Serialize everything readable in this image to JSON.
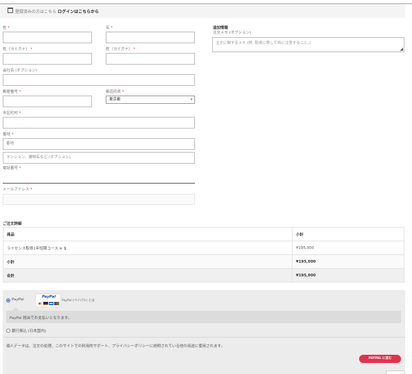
{
  "login": {
    "prompt": "登録済みの方はこちら",
    "link": "ログインはこちらから"
  },
  "billing": {
    "last_name": {
      "label": "姓",
      "value": ""
    },
    "first_name": {
      "label": "名",
      "value": ""
    },
    "last_name_kana": {
      "label": "姓（ヨミガナ）",
      "value": ""
    },
    "first_name_kana": {
      "label": "姓（ヨミガナ）",
      "value": ""
    },
    "company": {
      "label": "会社名 (オプション)",
      "value": ""
    },
    "postcode": {
      "label": "郵便番号",
      "value": ""
    },
    "prefecture": {
      "label": "都道府県",
      "value": "東京都"
    },
    "city": {
      "label": "市区町村",
      "value": ""
    },
    "address": {
      "label": "番地",
      "placeholder": "番地"
    },
    "address2": {
      "placeholder": "マンション、建物名など (オプション)"
    },
    "phone": {
      "label": "電話番号",
      "value": ""
    },
    "email": {
      "label": "メールアドレス",
      "value": ""
    },
    "required_mark": "*"
  },
  "additional": {
    "heading": "追加情報",
    "notes_label": "注文メモ (オプション)",
    "notes_placeholder": "注文に関するメモ (例: 配達に際して特に注意すること。)"
  },
  "order": {
    "heading": "ご注文詳細",
    "col_product": "商品",
    "col_subtotal": "小計",
    "item_name": "ライセンス取得1年短期コース",
    "item_qty": "× 1",
    "item_price": "¥195,000",
    "subtotal_label": "小計",
    "subtotal_value": "¥195,000",
    "total_label": "合計",
    "total_value": "¥195,000"
  },
  "payment": {
    "paypal_label": "PayPal",
    "paypal_logo_text": "PayPal",
    "paypal_about": "PayPal (ペイパル) とは",
    "paypal_desc": "PayPal 経由でお支払いとなります。",
    "bank_label": "銀行振込 (日本国内)",
    "privacy_text": "個人データは、注文の処理、このサイトでの利用的サポート、プライバシーポリシーに説明されている他の用途に使用されます。",
    "button_label": "PAYPAL に進む",
    "accent_color": "#e2334d",
    "paypal_blue": "#1a4ca0"
  }
}
